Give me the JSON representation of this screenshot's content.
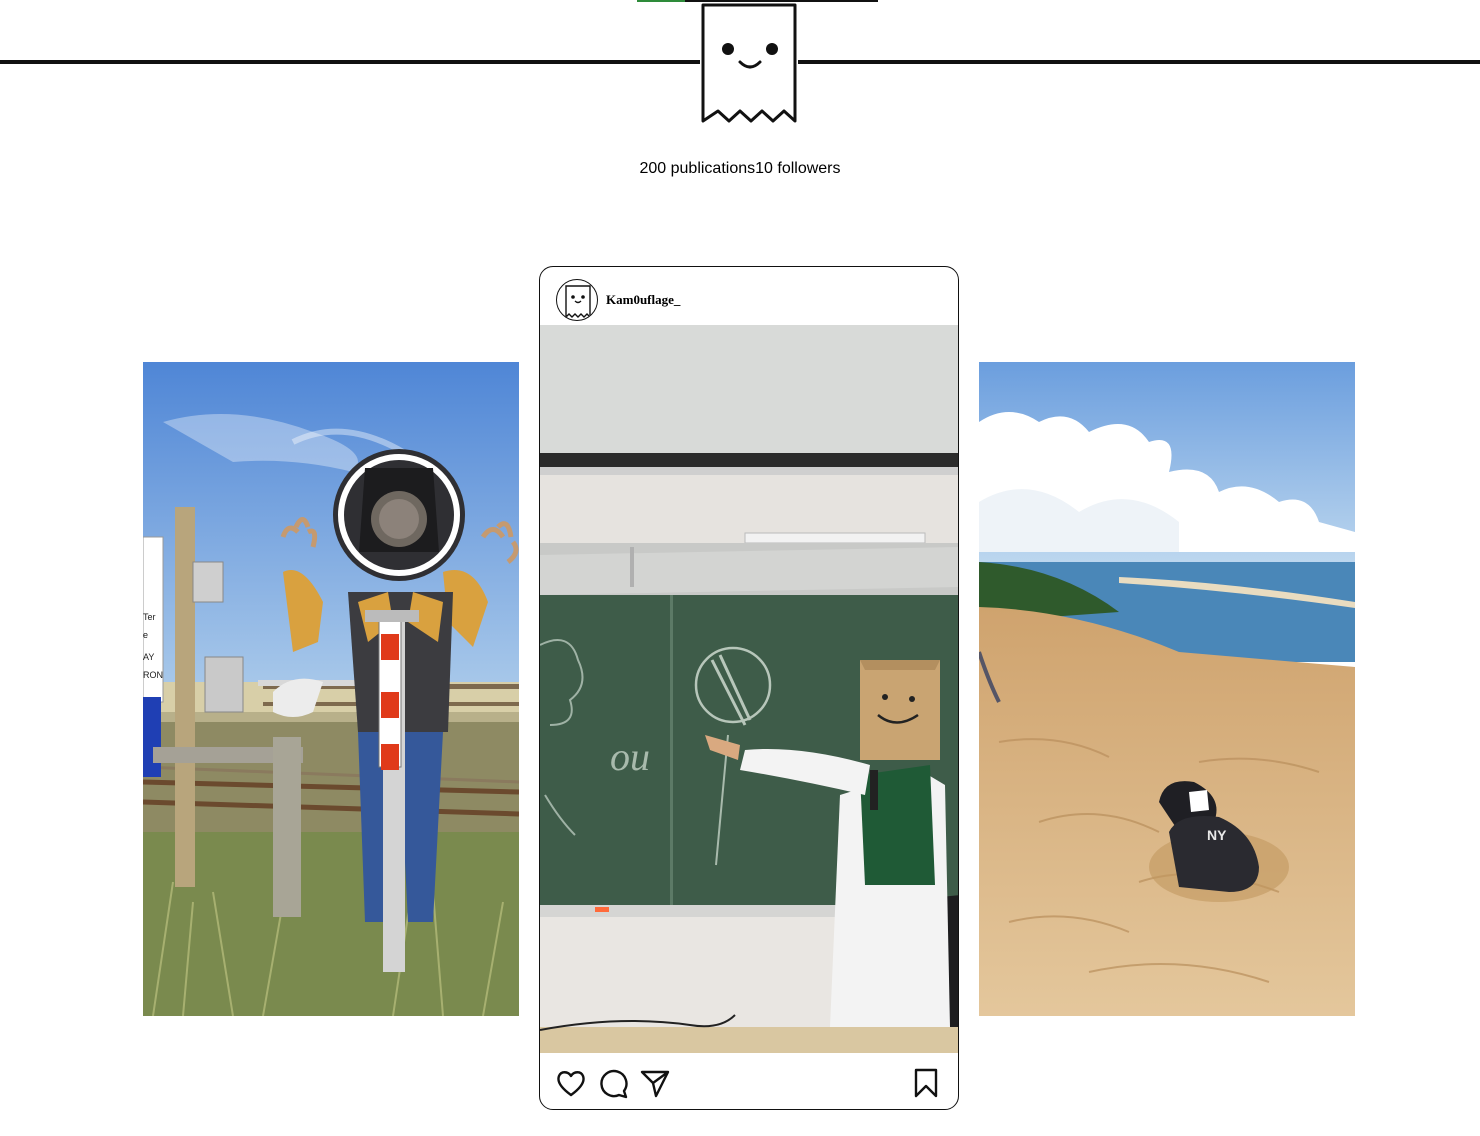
{
  "profile": {
    "logo_icon": "ghost-icon",
    "publications": "200 publications",
    "followers": "10 followers"
  },
  "post": {
    "username": "Kam0uflage_",
    "icons": {
      "like": "heart-icon",
      "comment": "comment-bubble-icon",
      "share": "send-paper-plane-icon",
      "save": "bookmark-icon"
    },
    "image_chalkboard_text": "ou"
  },
  "side_photos": {
    "left_sign_text": [
      "Ter",
      "e",
      "AY",
      "RON"
    ],
    "right_cap_text": "NY"
  },
  "colors": {
    "line": "#111111",
    "accent_green": "#2e8b3a",
    "background": "#ffffff"
  }
}
